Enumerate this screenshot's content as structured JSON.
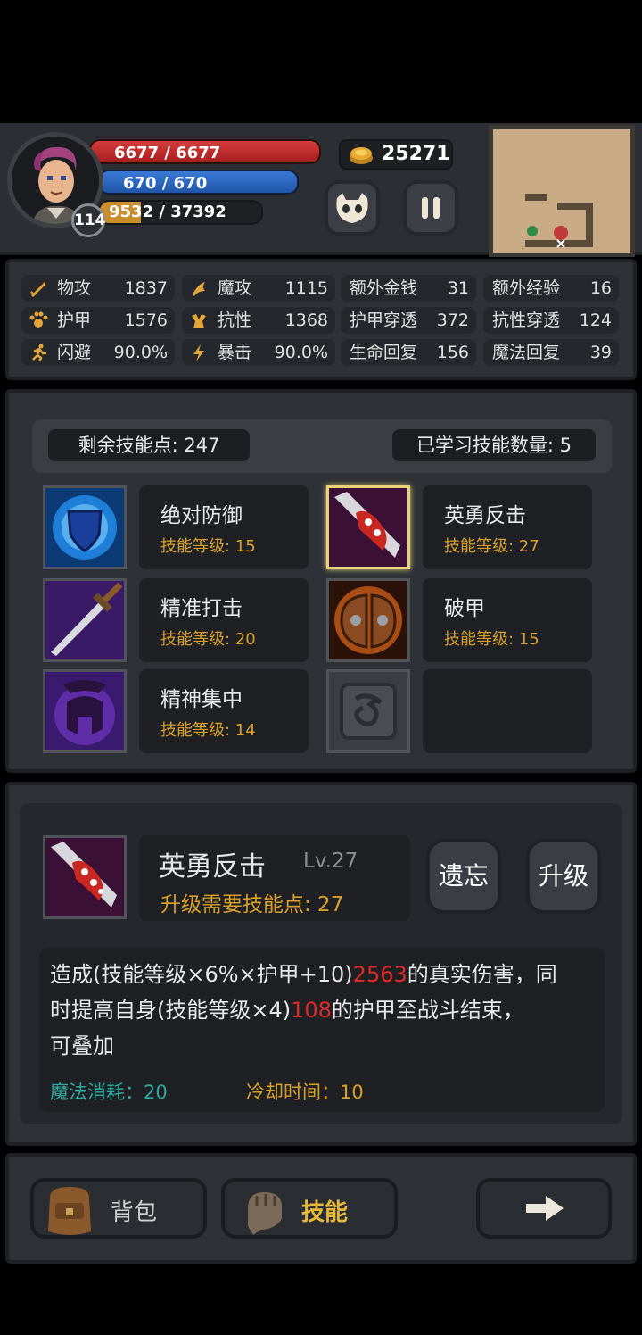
{
  "hud": {
    "level": "114",
    "hp": "6677 / 6677",
    "mp": "670 / 670",
    "xp": "9532 / 37392",
    "xp_fraction": 0.255,
    "gold": "25271"
  },
  "stats": [
    {
      "label": "物攻",
      "value": "1837",
      "icon": "sword-icon"
    },
    {
      "label": "魔攻",
      "value": "1115",
      "icon": "magic-icon"
    },
    {
      "label": "额外金钱",
      "value": "31"
    },
    {
      "label": "额外经验",
      "value": "16"
    },
    {
      "label": "护甲",
      "value": "1576",
      "icon": "paw-icon"
    },
    {
      "label": "抗性",
      "value": "1368",
      "icon": "resist-icon"
    },
    {
      "label": "护甲穿透",
      "value": "372"
    },
    {
      "label": "抗性穿透",
      "value": "124"
    },
    {
      "label": "闪避",
      "value": "90.0%",
      "icon": "run-icon"
    },
    {
      "label": "暴击",
      "value": "90.0%",
      "icon": "lightning-icon"
    },
    {
      "label": "生命回复",
      "value": "156"
    },
    {
      "label": "魔法回复",
      "value": "39"
    }
  ],
  "skills_header": {
    "remaining": "剩余技能点: 247",
    "learned": "已学习技能数量: 5"
  },
  "skills": [
    {
      "name": "绝对防御",
      "level": "技能等级: 15",
      "icon": "shield-icon"
    },
    {
      "name": "英勇反击",
      "level": "技能等级: 27",
      "icon": "bloody-blade-icon",
      "selected": true
    },
    {
      "name": "精准打击",
      "level": "技能等级: 20",
      "icon": "sword-icon"
    },
    {
      "name": "破甲",
      "level": "技能等级: 15",
      "icon": "broken-shield-icon"
    },
    {
      "name": "精神集中",
      "level": "技能等级: 14",
      "icon": "helmet-icon"
    }
  ],
  "detail": {
    "name": "英勇反击",
    "lv": "Lv.27",
    "cost": "升级需要技能点: 27",
    "forget": "遗忘",
    "upgrade": "升级",
    "desc_1": "造成(技能等级×6%×护甲+10)",
    "desc_2": "2563",
    "desc_3": "的真实伤害，同",
    "desc_4": "时提高自身(技能等级×4)",
    "desc_5": "108",
    "desc_6": "的护甲至战斗结束，",
    "desc_7": "可叠加",
    "mana": "魔法消耗：20",
    "cooldown": "冷却时间：10"
  },
  "bottom": {
    "bag": "背包",
    "skill": "技能"
  },
  "colors": {
    "gold_text": "#d9a12b",
    "mana_text": "#2fa9a0",
    "cooldown_text": "#d9a12b",
    "highlight_red": "#e02a2a"
  }
}
